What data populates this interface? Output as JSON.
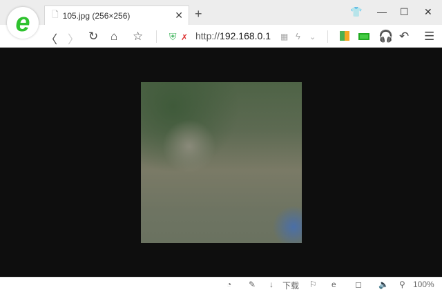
{
  "tab": {
    "title": "105.jpg (256×256)"
  },
  "address": {
    "scheme": "http://",
    "host": "192.168.0.1"
  },
  "status": {
    "download_label": "下载",
    "zoom": "100%"
  },
  "content": {
    "image_alt": "satellite image"
  },
  "colors": {
    "logo": "#2ec22e",
    "background": "#0e0e0e"
  }
}
